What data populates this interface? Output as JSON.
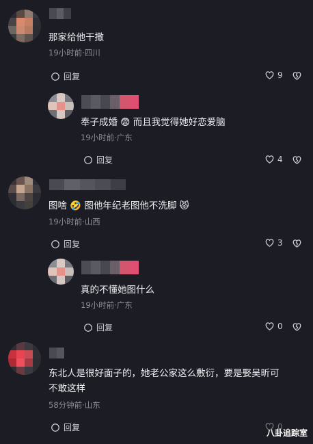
{
  "comments": [
    {
      "text": "那家给他干撒",
      "meta": "19小时前·四川",
      "reply_label": "回复",
      "likes": "9",
      "avatar_colors": [
        "#2b2b33",
        "#5a4a44",
        "#8f7a6e",
        "#3a3a40",
        "#4a4448",
        "#d98a6e",
        "#c78064",
        "#2e2e34",
        "#6c6660",
        "#c98a70",
        "#b67a62",
        "#2c2c33",
        "#3a3a41",
        "#7d6a60",
        "#5e524c",
        "#2c2c33"
      ],
      "name_colors": [
        "#4a4a52",
        "#5c5c64",
        "#3f3f47"
      ]
    },
    {
      "text": "奉子成婚 😨 而且我觉得她好恋爱脑",
      "meta": "19小时前·广东",
      "reply_label": "回复",
      "likes": "4",
      "avatar_colors": [
        "#8d8d92",
        "#d9c9c4",
        "#7a7a80",
        "#e0c4bc",
        "#e6928a",
        "#c8bfbb",
        "#6e6e74",
        "#d7c7c2",
        "#5c5c62"
      ],
      "name_colors": [
        "#4c4c54",
        "#5a5a62",
        "#484850",
        "#6a5f68",
        "#d4566e",
        "#e04e72"
      ]
    },
    {
      "text": "图啥 🤣 图他年纪老图他不洗脚 😾",
      "meta": "19小时前·山西",
      "reply_label": "回复",
      "likes": "3",
      "avatar_colors": [
        "#3a3436",
        "#6a5650",
        "#a08a7c",
        "#2e2e34",
        "#5a4c48",
        "#c7a690",
        "#8a7264",
        "#3a3a40",
        "#2e2e34",
        "#7a6a62",
        "#4e4440",
        "#2c2c32",
        "#2c2c33",
        "#3a3a40",
        "#44403e",
        "#2c2c33"
      ],
      "name_colors": [
        "#4a4a52",
        "#606068",
        "#55555d",
        "#4c4c54",
        "#3e3e46"
      ]
    },
    {
      "text": "真的不懂她图什么",
      "meta": "19小时前·广东",
      "reply_label": "回复",
      "likes": "0",
      "avatar_colors": [
        "#8d8d92",
        "#d9c9c4",
        "#7a7a80",
        "#e0c4bc",
        "#e6928a",
        "#c8bfbb",
        "#6e6e74",
        "#d7c7c2",
        "#5c5c62"
      ],
      "name_colors": [
        "#4c4c54",
        "#5a5a62",
        "#484850",
        "#6a5f68",
        "#d4566e",
        "#e04e72"
      ]
    },
    {
      "text": "东北人是很好面子的，她老公家这么敷衍，要是娶吴昕可\n不敢这样",
      "meta": "58分钟前·山东",
      "reply_label": "回复",
      "likes": "0",
      "avatar_colors": [
        "#2c2c33",
        "#5a3a40",
        "#3a3a40",
        "#2c2c33",
        "#c8323e",
        "#e84452",
        "#c84a52",
        "#2e2e34",
        "#b02a36",
        "#f0505e",
        "#a83a44",
        "#2c2c33",
        "#2c2c33",
        "#6a3a40",
        "#3a3a40",
        "#2c2c33"
      ],
      "name_colors": [
        "#4a4a52",
        "#55555d"
      ]
    }
  ],
  "watermark": "八卦追踪室"
}
